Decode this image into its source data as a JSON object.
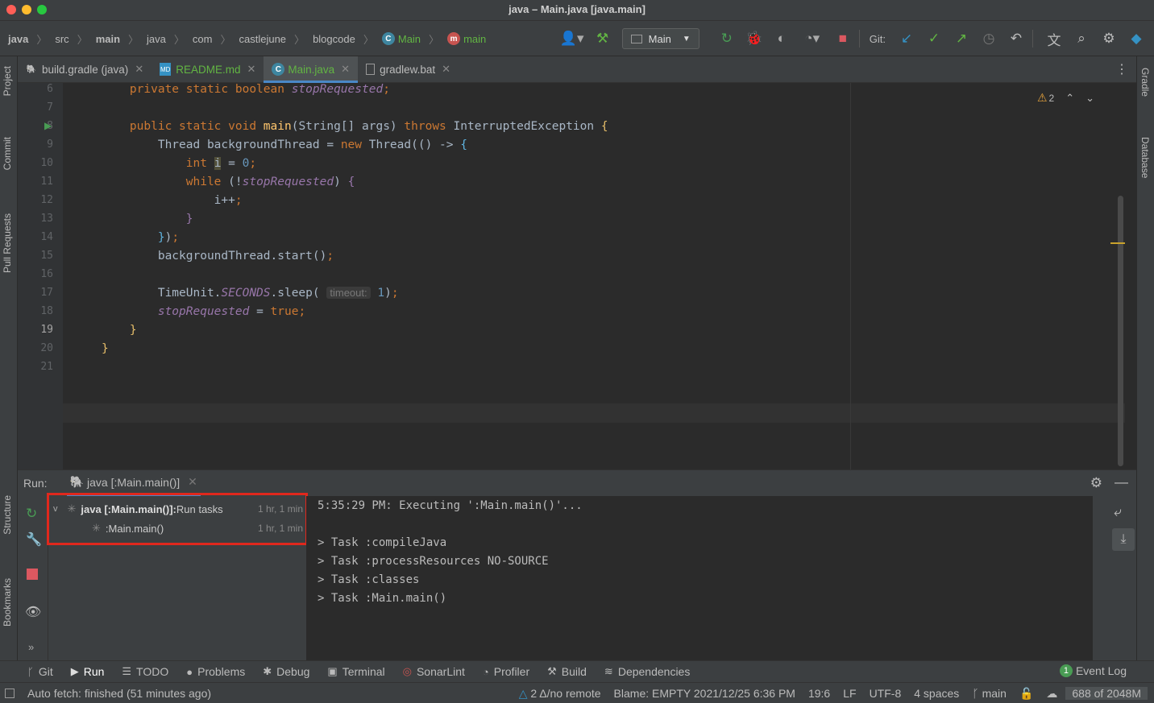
{
  "window": {
    "title": "java – Main.java [java.main]"
  },
  "breadcrumb": [
    "java",
    "src",
    "main",
    "java",
    "com",
    "castlejune",
    "blogcode",
    "Main",
    "main"
  ],
  "toolbar": {
    "run_config": "Main",
    "git_label": "Git:"
  },
  "tabs": [
    {
      "label": "build.gradle (java)"
    },
    {
      "label": "README.md"
    },
    {
      "label": "Main.java"
    },
    {
      "label": "gradlew.bat"
    }
  ],
  "editor": {
    "warning_count": "2",
    "line_numbers": [
      "6",
      "7",
      "8",
      "9",
      "10",
      "11",
      "12",
      "13",
      "14",
      "15",
      "16",
      "17",
      "18",
      "19",
      "20",
      "21"
    ],
    "code": {
      "l6a": "    private static boolean ",
      "l6b": "stopRequested",
      "l8a": "    public static void ",
      "l8b": "main",
      "l8c": "(String[] args) ",
      "l8d": "throws",
      " l8e": "",
      "l8f": " InterruptedException {",
      "l9a": "        Thread backgroundThread = ",
      "l9b": "new",
      " l9c": "",
      "l9d": " Thread(() -> {",
      "l10a": "            int",
      "l10b": " i = ",
      "l10c": "0",
      "l10d": ";",
      "l11a": "            while",
      " l11b": "",
      "l11c": " (!",
      "l11d": "stopRequested",
      "l11e": ") {",
      "l12": "                i++;",
      "l13": "            }",
      "l14": "        });",
      "l15": "        backgroundThread.start();",
      "l17a": "        TimeUnit.",
      "l17b": "SECONDS",
      "l17c": ".sleep( ",
      "l17hint": "timeout:",
      "l17d": " ",
      "l17e": "1",
      "l17f": ");",
      "l18a": "        ",
      "l18b": "stopRequested",
      "l18c": " = ",
      "l18d": "true",
      "l18e": ";",
      "l19": "    }",
      "l20": "}"
    }
  },
  "run": {
    "label": "Run:",
    "tab": "java [:Main.main()]",
    "tree": [
      {
        "name": "java [:Main.main()]:",
        "desc": " Run tasks",
        "time": "1 hr, 1 min"
      },
      {
        "name": ":Main.main()",
        "desc": "",
        "time": "1 hr, 1 min"
      }
    ],
    "console": [
      "5:35:29 PM: Executing ':Main.main()'...",
      "",
      "> Task :compileJava",
      "> Task :processResources NO-SOURCE",
      "> Task :classes",
      "> Task :Main.main()"
    ]
  },
  "left_tabs": [
    "Project",
    "Commit",
    "Pull Requests",
    "Structure",
    "Bookmarks"
  ],
  "right_tabs": [
    "Gradle",
    "Database"
  ],
  "tool_windows": [
    "Git",
    "Run",
    "TODO",
    "Problems",
    "Debug",
    "Terminal",
    "SonarLint",
    "Profiler",
    "Build",
    "Dependencies"
  ],
  "event_log": {
    "count": "1",
    "label": "Event Log"
  },
  "status": {
    "left": "Auto fetch: finished (51 minutes ago)",
    "vcs": "2 Δ/no remote",
    "blame": "Blame: EMPTY 2021/12/25 6:36 PM",
    "position": "19:6",
    "line_sep": "LF",
    "encoding": "UTF-8",
    "indent": "4 spaces",
    "branch": "main",
    "memory": "688 of 2048M"
  }
}
